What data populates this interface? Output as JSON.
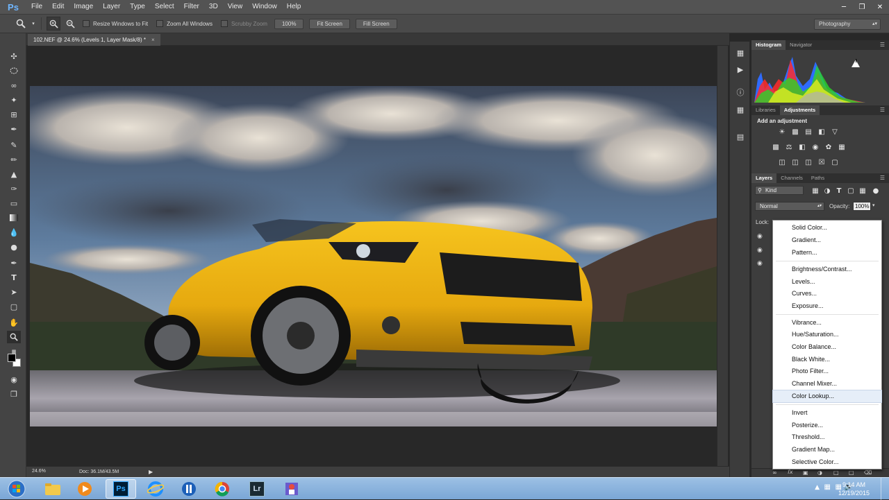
{
  "app": {
    "logo": "Ps"
  },
  "menu": [
    "File",
    "Edit",
    "Image",
    "Layer",
    "Type",
    "Select",
    "Filter",
    "3D",
    "View",
    "Window",
    "Help"
  ],
  "window_controls": [
    "minimize",
    "restore",
    "close"
  ],
  "options_bar": {
    "resize_windows": "Resize Windows to Fit",
    "zoom_all": "Zoom All Windows",
    "scrubby_zoom": "Scrubby Zoom",
    "zoom_100": "100%",
    "fit_screen": "Fit Screen",
    "fill_screen": "Fill Screen",
    "workspace": "Photography"
  },
  "document": {
    "tab_title": "102.NEF @ 24.6% (Levels 1, Layer Mask/8) *",
    "tab_close": "×",
    "zoom": "24.6%",
    "doc_info": "Doc: 36.1M/43.5M"
  },
  "panels": {
    "histogram_tabs": [
      "Histogram",
      "Navigator"
    ],
    "adjust_tabs": [
      "Libraries",
      "Adjustments"
    ],
    "add_adjustment": "Add an adjustment",
    "layers_tabs": [
      "Layers",
      "Channels",
      "Paths"
    ],
    "kind_filter": "Kind",
    "blend_mode": "Normal",
    "opacity_label": "Opacity:",
    "opacity_value": "100%",
    "lock_label": "Lock:",
    "warning_icon": "!"
  },
  "adjustment_menu": {
    "groups": [
      [
        "Solid Color...",
        "Gradient...",
        "Pattern..."
      ],
      [
        "Brightness/Contrast...",
        "Levels...",
        "Curves...",
        "Exposure..."
      ],
      [
        "Vibrance...",
        "Hue/Saturation...",
        "Color Balance...",
        "Black  White...",
        "Photo Filter...",
        "Channel Mixer...",
        "Color Lookup..."
      ],
      [
        "Invert",
        "Posterize...",
        "Threshold...",
        "Gradient Map...",
        "Selective Color..."
      ]
    ],
    "highlighted": "Color Lookup..."
  },
  "taskbar": {
    "time": "9:14 AM",
    "date": "12/19/2015",
    "ps_label": "Ps",
    "lr_label": "Lr"
  }
}
